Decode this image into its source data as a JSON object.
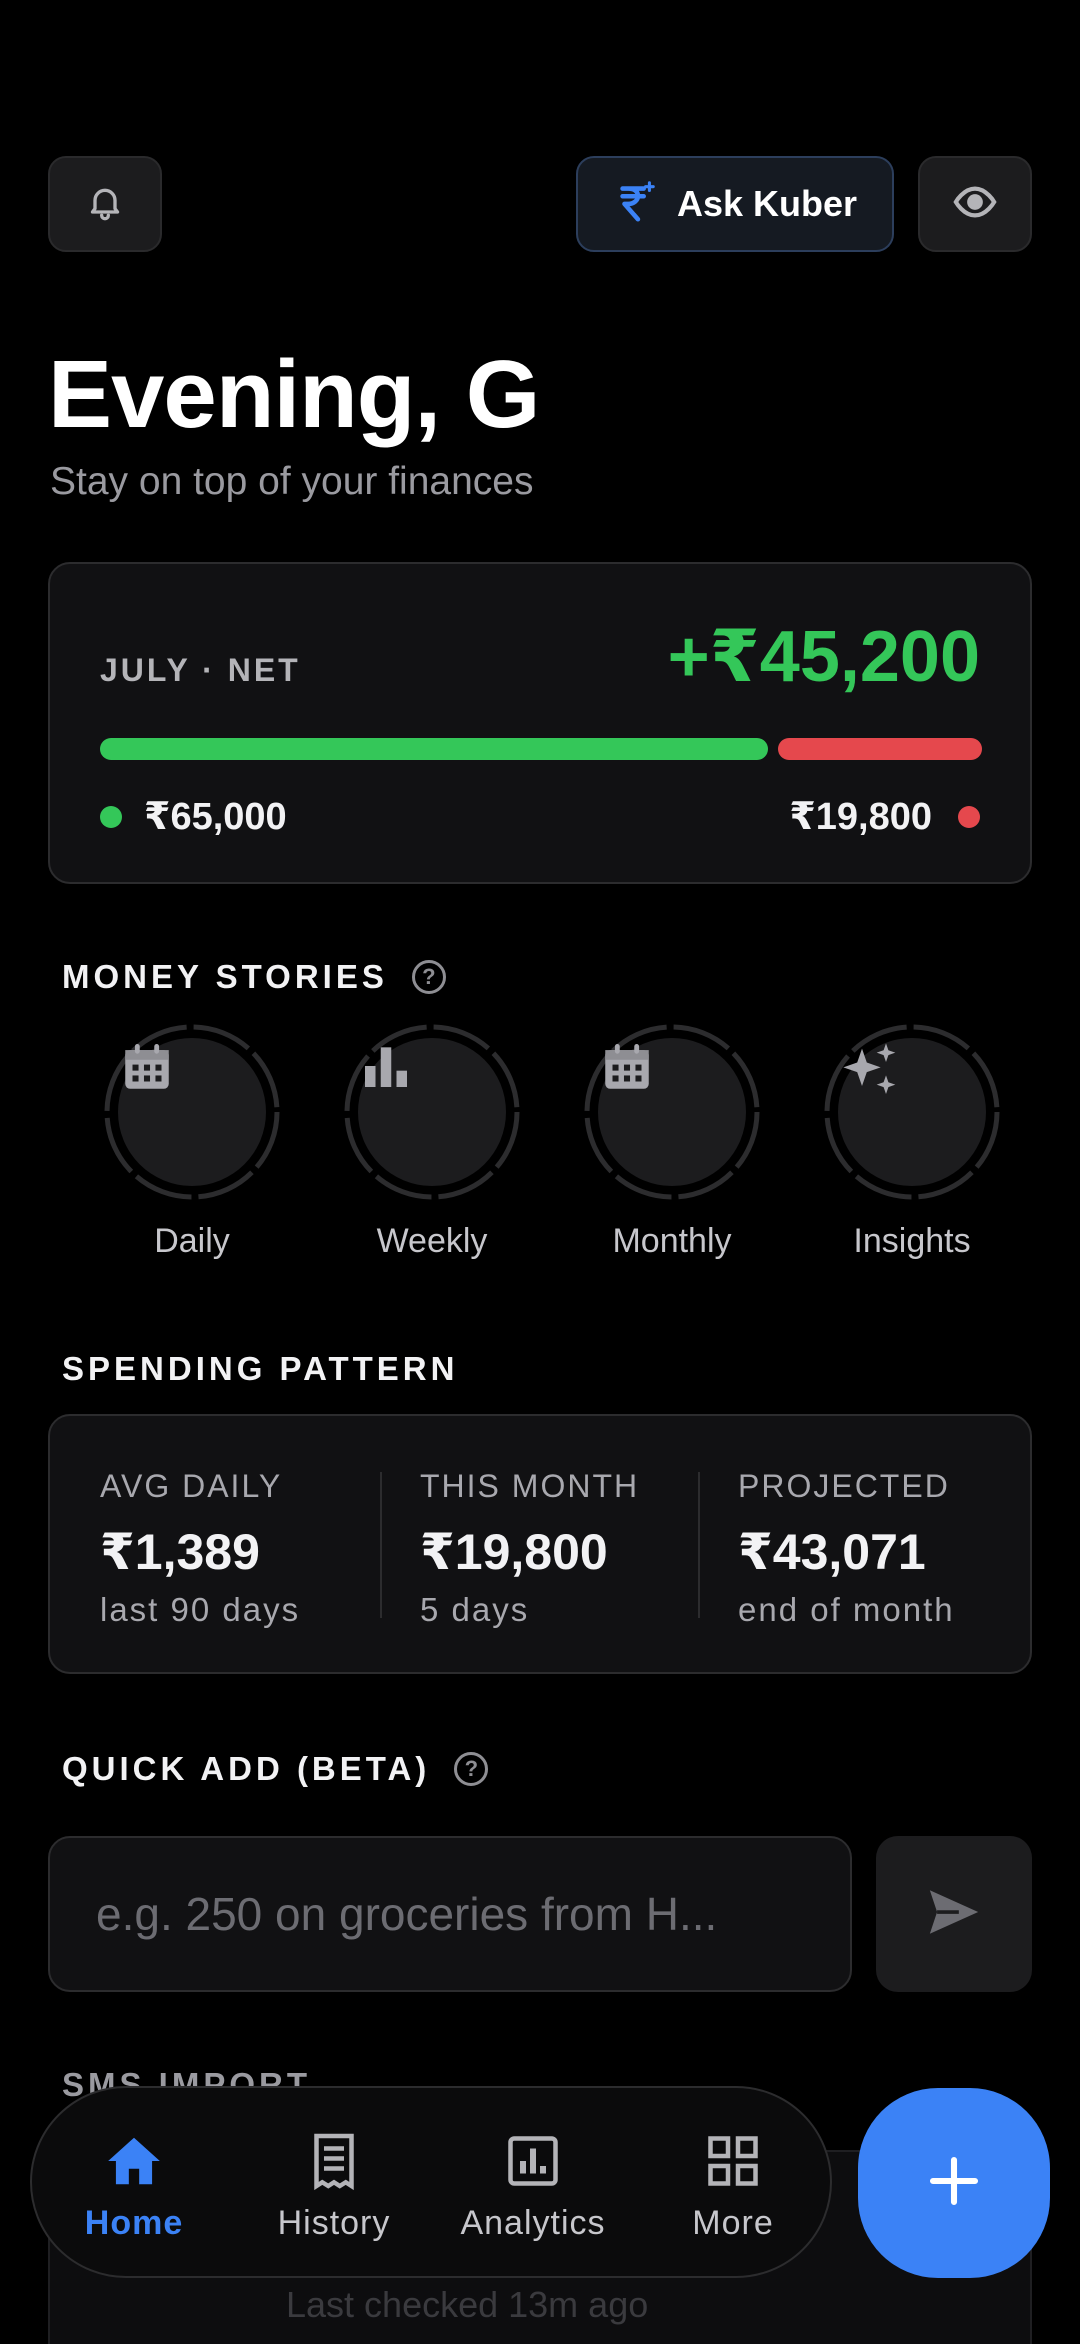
{
  "header": {
    "ask_label": "Ask Kuber",
    "greeting": "Evening, G",
    "subtitle": "Stay on top of your finances"
  },
  "net_card": {
    "label": "JULY · NET",
    "net_amount": "+₹45,200",
    "income": "₹65,000",
    "expense": "₹19,800",
    "income_share": 0.766,
    "income_color": "#34c759",
    "expense_color": "#e5484d"
  },
  "stories": {
    "title": "MONEY STORIES",
    "items": [
      {
        "label": "Daily",
        "icon": "calendar-icon"
      },
      {
        "label": "Weekly",
        "icon": "bar-chart-icon"
      },
      {
        "label": "Monthly",
        "icon": "calendar-icon"
      },
      {
        "label": "Insights",
        "icon": "sparkles-icon"
      }
    ]
  },
  "spending": {
    "title": "SPENDING PATTERN",
    "cols": [
      {
        "head": "AVG DAILY",
        "value": "₹1,389",
        "sub": "last 90 days"
      },
      {
        "head": "THIS MONTH",
        "value": "₹19,800",
        "sub": "5 days"
      },
      {
        "head": "PROJECTED",
        "value": "₹43,071",
        "sub": "end of month"
      }
    ]
  },
  "quick_add": {
    "title": "QUICK ADD (BETA)",
    "placeholder": "e.g. 250 on groceries from H..."
  },
  "sms": {
    "title": "SMS IMPORT",
    "subtitle": "Last checked 13m ago"
  },
  "nav": {
    "items": [
      {
        "label": "Home",
        "icon": "home-icon",
        "active": true
      },
      {
        "label": "History",
        "icon": "receipt-icon",
        "active": false
      },
      {
        "label": "Analytics",
        "icon": "analytics-icon",
        "active": false
      },
      {
        "label": "More",
        "icon": "grid-icon",
        "active": false
      }
    ]
  },
  "colors": {
    "accent": "#3b82f6",
    "positive": "#34c759",
    "negative": "#e5484d"
  }
}
